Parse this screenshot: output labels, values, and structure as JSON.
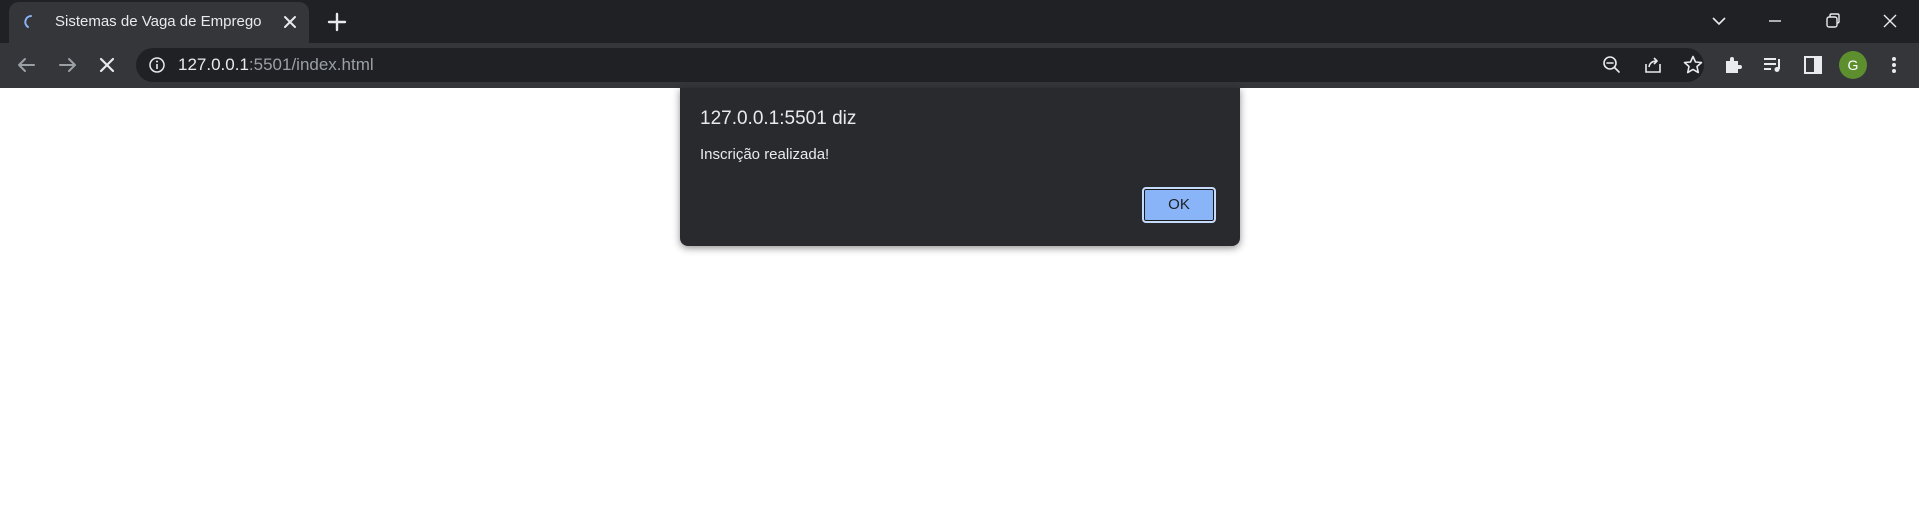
{
  "browser": {
    "tab": {
      "title": "Sistemas de Vaga de Emprego",
      "favicon": "loading-spinner-icon"
    },
    "new_tab_icon": "plus-icon",
    "window_controls": [
      "chevron-down-icon",
      "minimize-icon",
      "restore-icon",
      "close-icon"
    ],
    "nav": {
      "back_icon": "arrow-left-icon",
      "forward_icon": "arrow-right-icon",
      "stop_icon": "close-icon"
    },
    "omnibox": {
      "host": "127.0.0.1",
      "rest": ":5501/index.html",
      "info_icon": "info-icon",
      "actions": [
        "zoom-out-icon",
        "share-icon",
        "star-icon"
      ]
    },
    "toolbar_icons": [
      "puzzle-icon",
      "media-queue-icon",
      "side-panel-icon",
      "kebab-menu-icon"
    ],
    "profile_initial": "G",
    "colors": {
      "titlebar": "#202124",
      "toolbar": "#35363a",
      "accent": "#8ab4f8",
      "avatar": "#5e8f2f"
    }
  },
  "dialog": {
    "origin": "127.0.0.1:5501 diz",
    "message": "Inscrição realizada!",
    "ok_label": "OK"
  }
}
